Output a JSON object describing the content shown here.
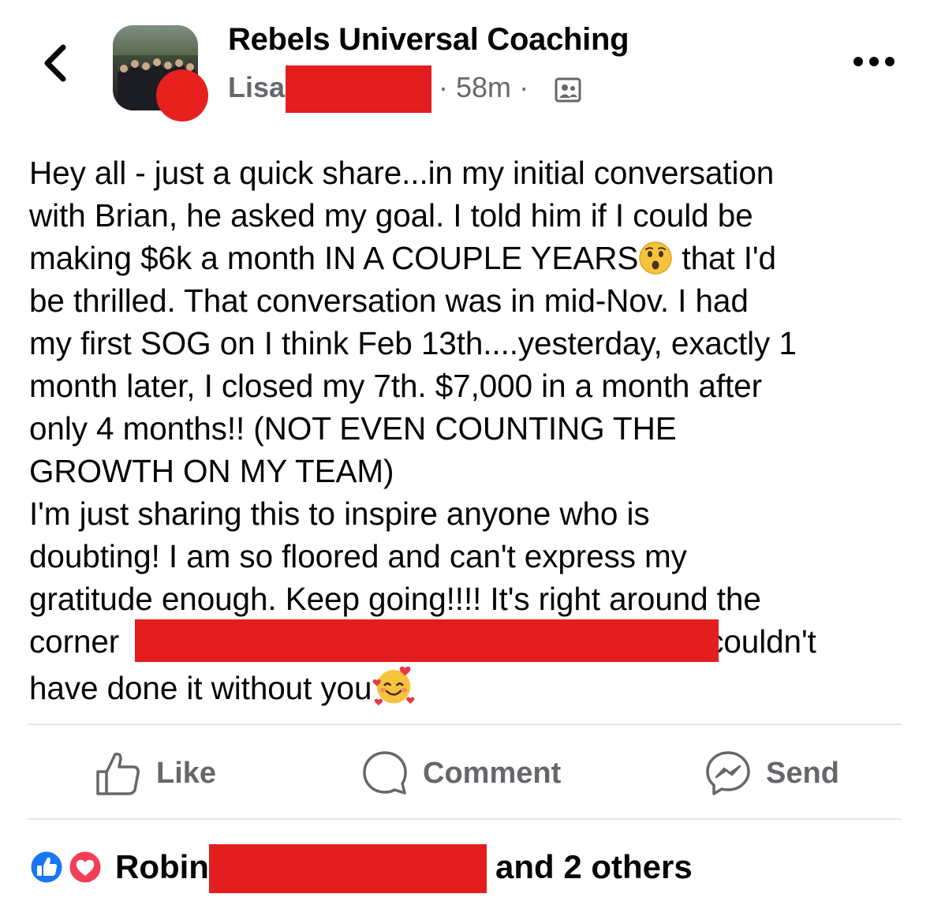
{
  "header": {
    "group_name": "Rebels Universal Coaching",
    "author_visible": "Lisa",
    "time_separator": "·",
    "time": "58m",
    "time_trailing_separator": "·"
  },
  "post": {
    "line1": "Hey all - just a quick share...in my initial conversation",
    "line2": "with Brian, he asked my goal. I told him if I could be",
    "line3a": "making $6k a month IN A COUPLE YEARS",
    "line3b": " that I'd",
    "line4": "be thrilled. That conversation was in mid-Nov. I had",
    "line5": "my first SOG on I think Feb 13th....yesterday, exactly 1",
    "line6": "month later, I closed my 7th. $7,000 in a month after",
    "line7": "only 4 months!! (NOT EVEN COUNTING THE",
    "line8": "GROWTH ON MY TEAM)",
    "line9": "I'm just sharing this to inspire anyone who is",
    "line10": "doubting! I am so floored and can't express my",
    "line11": "gratitude enough. Keep going!!!! It's right around the",
    "line12a": "corner",
    "line12b": "couldn't",
    "line13": "have done it without you",
    "emoji1": "astonished-face",
    "emoji2": "smiling-face-with-hearts"
  },
  "actions": {
    "like": "Like",
    "comment": "Comment",
    "send": "Send"
  },
  "reactions": {
    "first_name": "Robin",
    "others": "and 2 others",
    "icons": [
      "like-reaction-icon",
      "love-reaction-icon"
    ]
  },
  "colors": {
    "redaction": "#e41e1e",
    "secondary_text": "#65676b",
    "like_blue": "#1877f2",
    "love_red": "#f33e58"
  }
}
